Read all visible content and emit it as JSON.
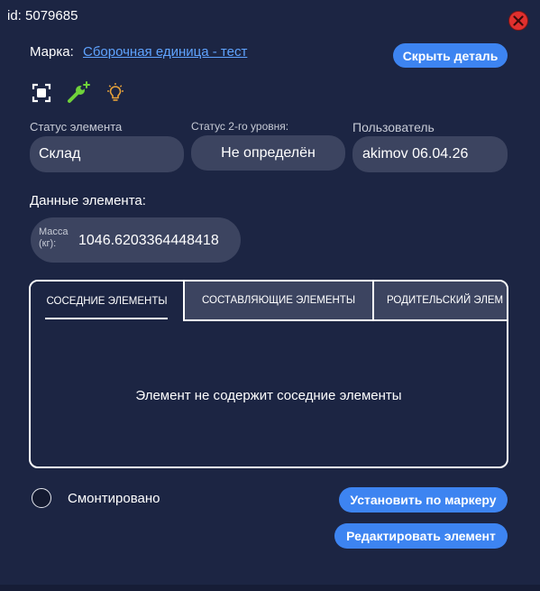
{
  "header": {
    "id_text": "id: 5079685"
  },
  "mark": {
    "label": "Марка:",
    "link_text": "Сборочная единица - тест"
  },
  "buttons": {
    "hide_detail": "Скрыть деталь",
    "set_by_marker": "Установить по маркеру",
    "edit_element": "Редактировать элемент"
  },
  "tools": [
    "focus-frame-icon",
    "add-wrench-icon",
    "lightbulb-icon"
  ],
  "fields": {
    "status": {
      "label": "Статус элемента",
      "value": "Склад"
    },
    "status2": {
      "label": "Статус 2-го уровня:",
      "value": "Не определён"
    },
    "user": {
      "label": "Пользователь",
      "value": "akimov 06.04.26"
    }
  },
  "element_data": {
    "label": "Данные элемента:",
    "mass_label_line1": "Масса",
    "mass_label_line2": "(кг):",
    "mass_value": "1046.6203364448418"
  },
  "tabs": [
    {
      "label": "СОСЕДНИЕ ЭЛЕМЕНТЫ",
      "active": true
    },
    {
      "label": "СОСТАВЛЯЮЩИЕ ЭЛЕМЕНТЫ",
      "active": false
    },
    {
      "label": "РОДИТЕЛЬСКИЙ ЭЛЕМ",
      "active": false
    }
  ],
  "tab_content": {
    "empty_message": "Элемент не содержит соседние элементы"
  },
  "mounted": {
    "label": "Смонтировано",
    "checked": false
  },
  "colors": {
    "background": "#1c2543",
    "field_bg": "#3c4460",
    "accent": "#3d84f1",
    "link": "#5fa3ff",
    "close": "#e0302e",
    "wrench": "#6fd23a",
    "bulb": "#e8a33a"
  }
}
